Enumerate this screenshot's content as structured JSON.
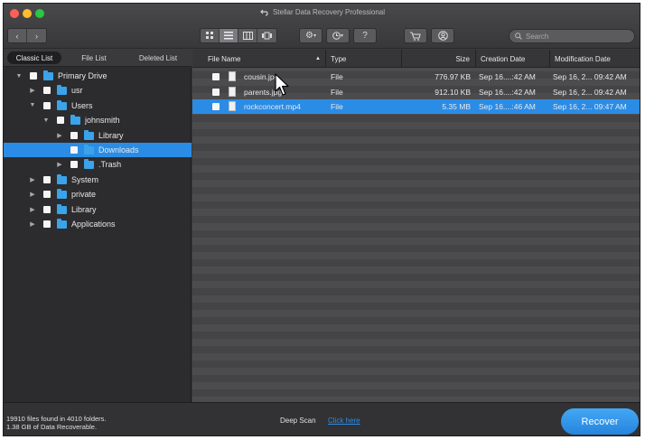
{
  "window": {
    "title": "Stellar Data Recovery Professional",
    "title_icon": "undo-arrow-icon"
  },
  "toolbar": {
    "back_icon": "chevron-left-icon",
    "forward_icon": "chevron-right-icon",
    "view_modes": [
      "grid-icon",
      "list-icon",
      "columns-icon",
      "coverflow-icon"
    ],
    "selected_view": "list-icon",
    "settings_icon": "gear-icon",
    "history_icon": "clock-icon",
    "help_label": "?",
    "cart_icon": "cart-icon",
    "account_icon": "user-icon",
    "search_placeholder": "Search"
  },
  "left_pane": {
    "tabs": [
      "Classic List",
      "File List",
      "Deleted List"
    ],
    "active_tab": "Classic List",
    "tree": [
      {
        "label": "Primary Drive",
        "depth": 0,
        "expanded": true,
        "selected": false
      },
      {
        "label": "usr",
        "depth": 1,
        "expanded": false,
        "selected": false
      },
      {
        "label": "Users",
        "depth": 1,
        "expanded": true,
        "selected": false
      },
      {
        "label": "johnsmith",
        "depth": 2,
        "expanded": true,
        "selected": false
      },
      {
        "label": "Library",
        "depth": 3,
        "expanded": false,
        "selected": false
      },
      {
        "label": "Downloads",
        "depth": 3,
        "expanded": null,
        "selected": true
      },
      {
        "label": ".Trash",
        "depth": 3,
        "expanded": false,
        "selected": false
      },
      {
        "label": "System",
        "depth": 1,
        "expanded": false,
        "selected": false
      },
      {
        "label": "private",
        "depth": 1,
        "expanded": false,
        "selected": false
      },
      {
        "label": "Library",
        "depth": 1,
        "expanded": false,
        "selected": false
      },
      {
        "label": "Applications",
        "depth": 1,
        "expanded": false,
        "selected": false
      }
    ]
  },
  "file_list": {
    "columns": {
      "name": "File Name",
      "type": "Type",
      "size": "Size",
      "created": "Creation Date",
      "modified": "Modification Date"
    },
    "sort_icon": "sort-arrow-icon",
    "rows": [
      {
        "name": "cousin.jpg",
        "type": "File",
        "size": "776.97 KB",
        "created": "Sep 16....:42 AM",
        "modified": "Sep 16, 2... 09:42 AM",
        "selected": false
      },
      {
        "name": "parents.jpg",
        "type": "File",
        "size": "912.10 KB",
        "created": "Sep 16....:42 AM",
        "modified": "Sep 16, 2... 09:42 AM",
        "selected": false
      },
      {
        "name": "rockconcert.mp4",
        "type": "File",
        "size": "5.35 MB",
        "created": "Sep 16....:46 AM",
        "modified": "Sep 16, 2... 09:47 AM",
        "selected": true
      }
    ]
  },
  "status": {
    "line1": "19910 files found in 4010 folders.",
    "line2": "1.38 GB of Data Recoverable.",
    "deep_scan_label": "Deep Scan",
    "click_here": "Click here",
    "recover_button": "Recover"
  },
  "colors": {
    "accent": "#2b8ce6",
    "folder": "#3aa3ea",
    "traffic_close": "#ff5f57",
    "traffic_min": "#febc2e",
    "traffic_max": "#28c840"
  }
}
